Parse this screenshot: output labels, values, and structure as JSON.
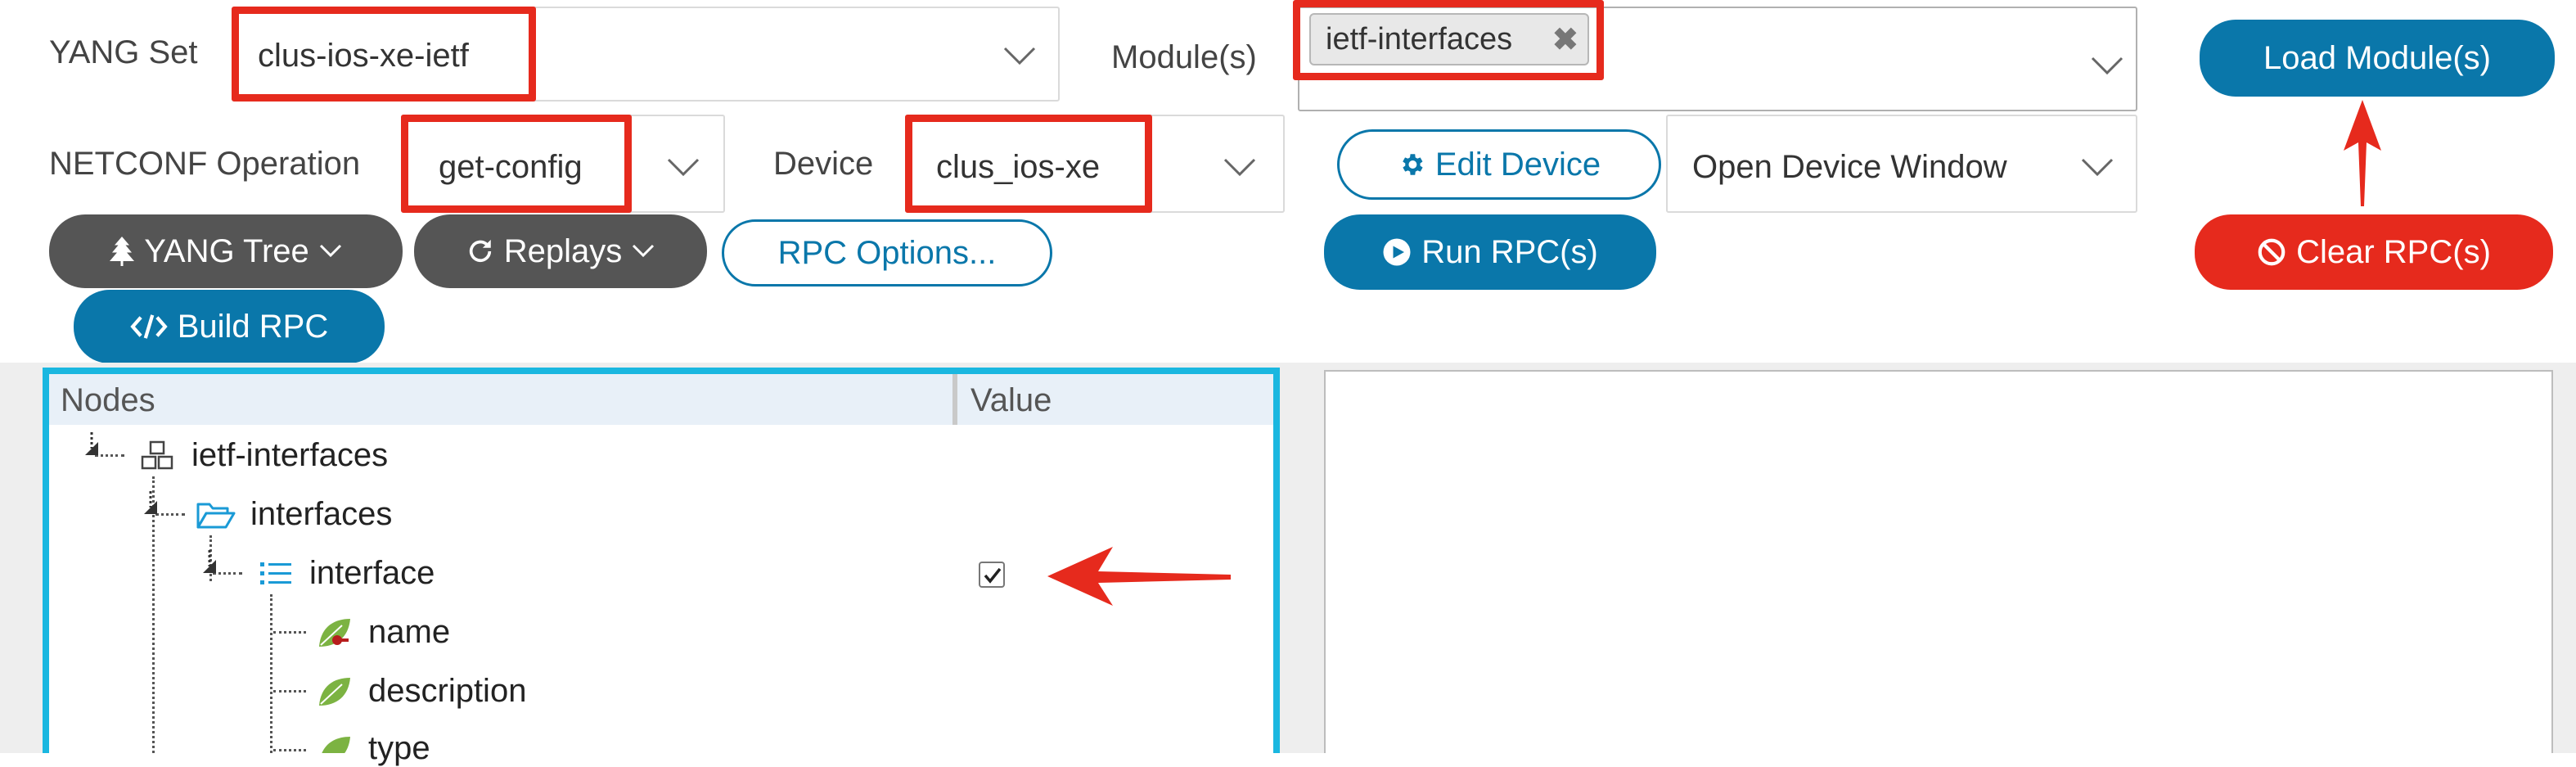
{
  "top": {
    "yang_set": {
      "label": "YANG Set",
      "value": "clus-ios-xe-ietf"
    },
    "modules": {
      "label": "Module(s)",
      "chips": [
        "ietf-interfaces"
      ]
    },
    "load_modules_label": "Load Module(s)",
    "netconf_operation": {
      "label": "NETCONF Operation",
      "value": "get-config"
    },
    "device": {
      "label": "Device",
      "value": "clus_ios-xe"
    },
    "edit_device_label": "Edit Device",
    "open_device_window": {
      "value": "Open Device Window"
    }
  },
  "buttons": {
    "yang_tree": "YANG Tree",
    "replays": "Replays",
    "rpc_options": "RPC Options...",
    "run_rpc": "Run RPC(s)",
    "clear_rpc": "Clear RPC(s)",
    "build_rpc": "Build RPC"
  },
  "tree": {
    "columns": [
      "Nodes",
      "Value"
    ],
    "nodes": [
      {
        "label": "ietf-interfaces",
        "icon": "module-icon"
      },
      {
        "label": "interfaces",
        "icon": "folder-open-icon"
      },
      {
        "label": "interface",
        "icon": "list-icon",
        "checked": true
      },
      {
        "label": "name",
        "icon": "key-leaf-icon"
      },
      {
        "label": "description",
        "icon": "leaf-icon"
      },
      {
        "label": "type",
        "icon": "leaf-icon"
      }
    ]
  },
  "colors": {
    "highlight_box": "#e62a1d",
    "primary_button": "#0a77aa",
    "danger_button": "#e62a1d",
    "secondary_button": "#555555",
    "tree_border": "#1ab7e0"
  }
}
